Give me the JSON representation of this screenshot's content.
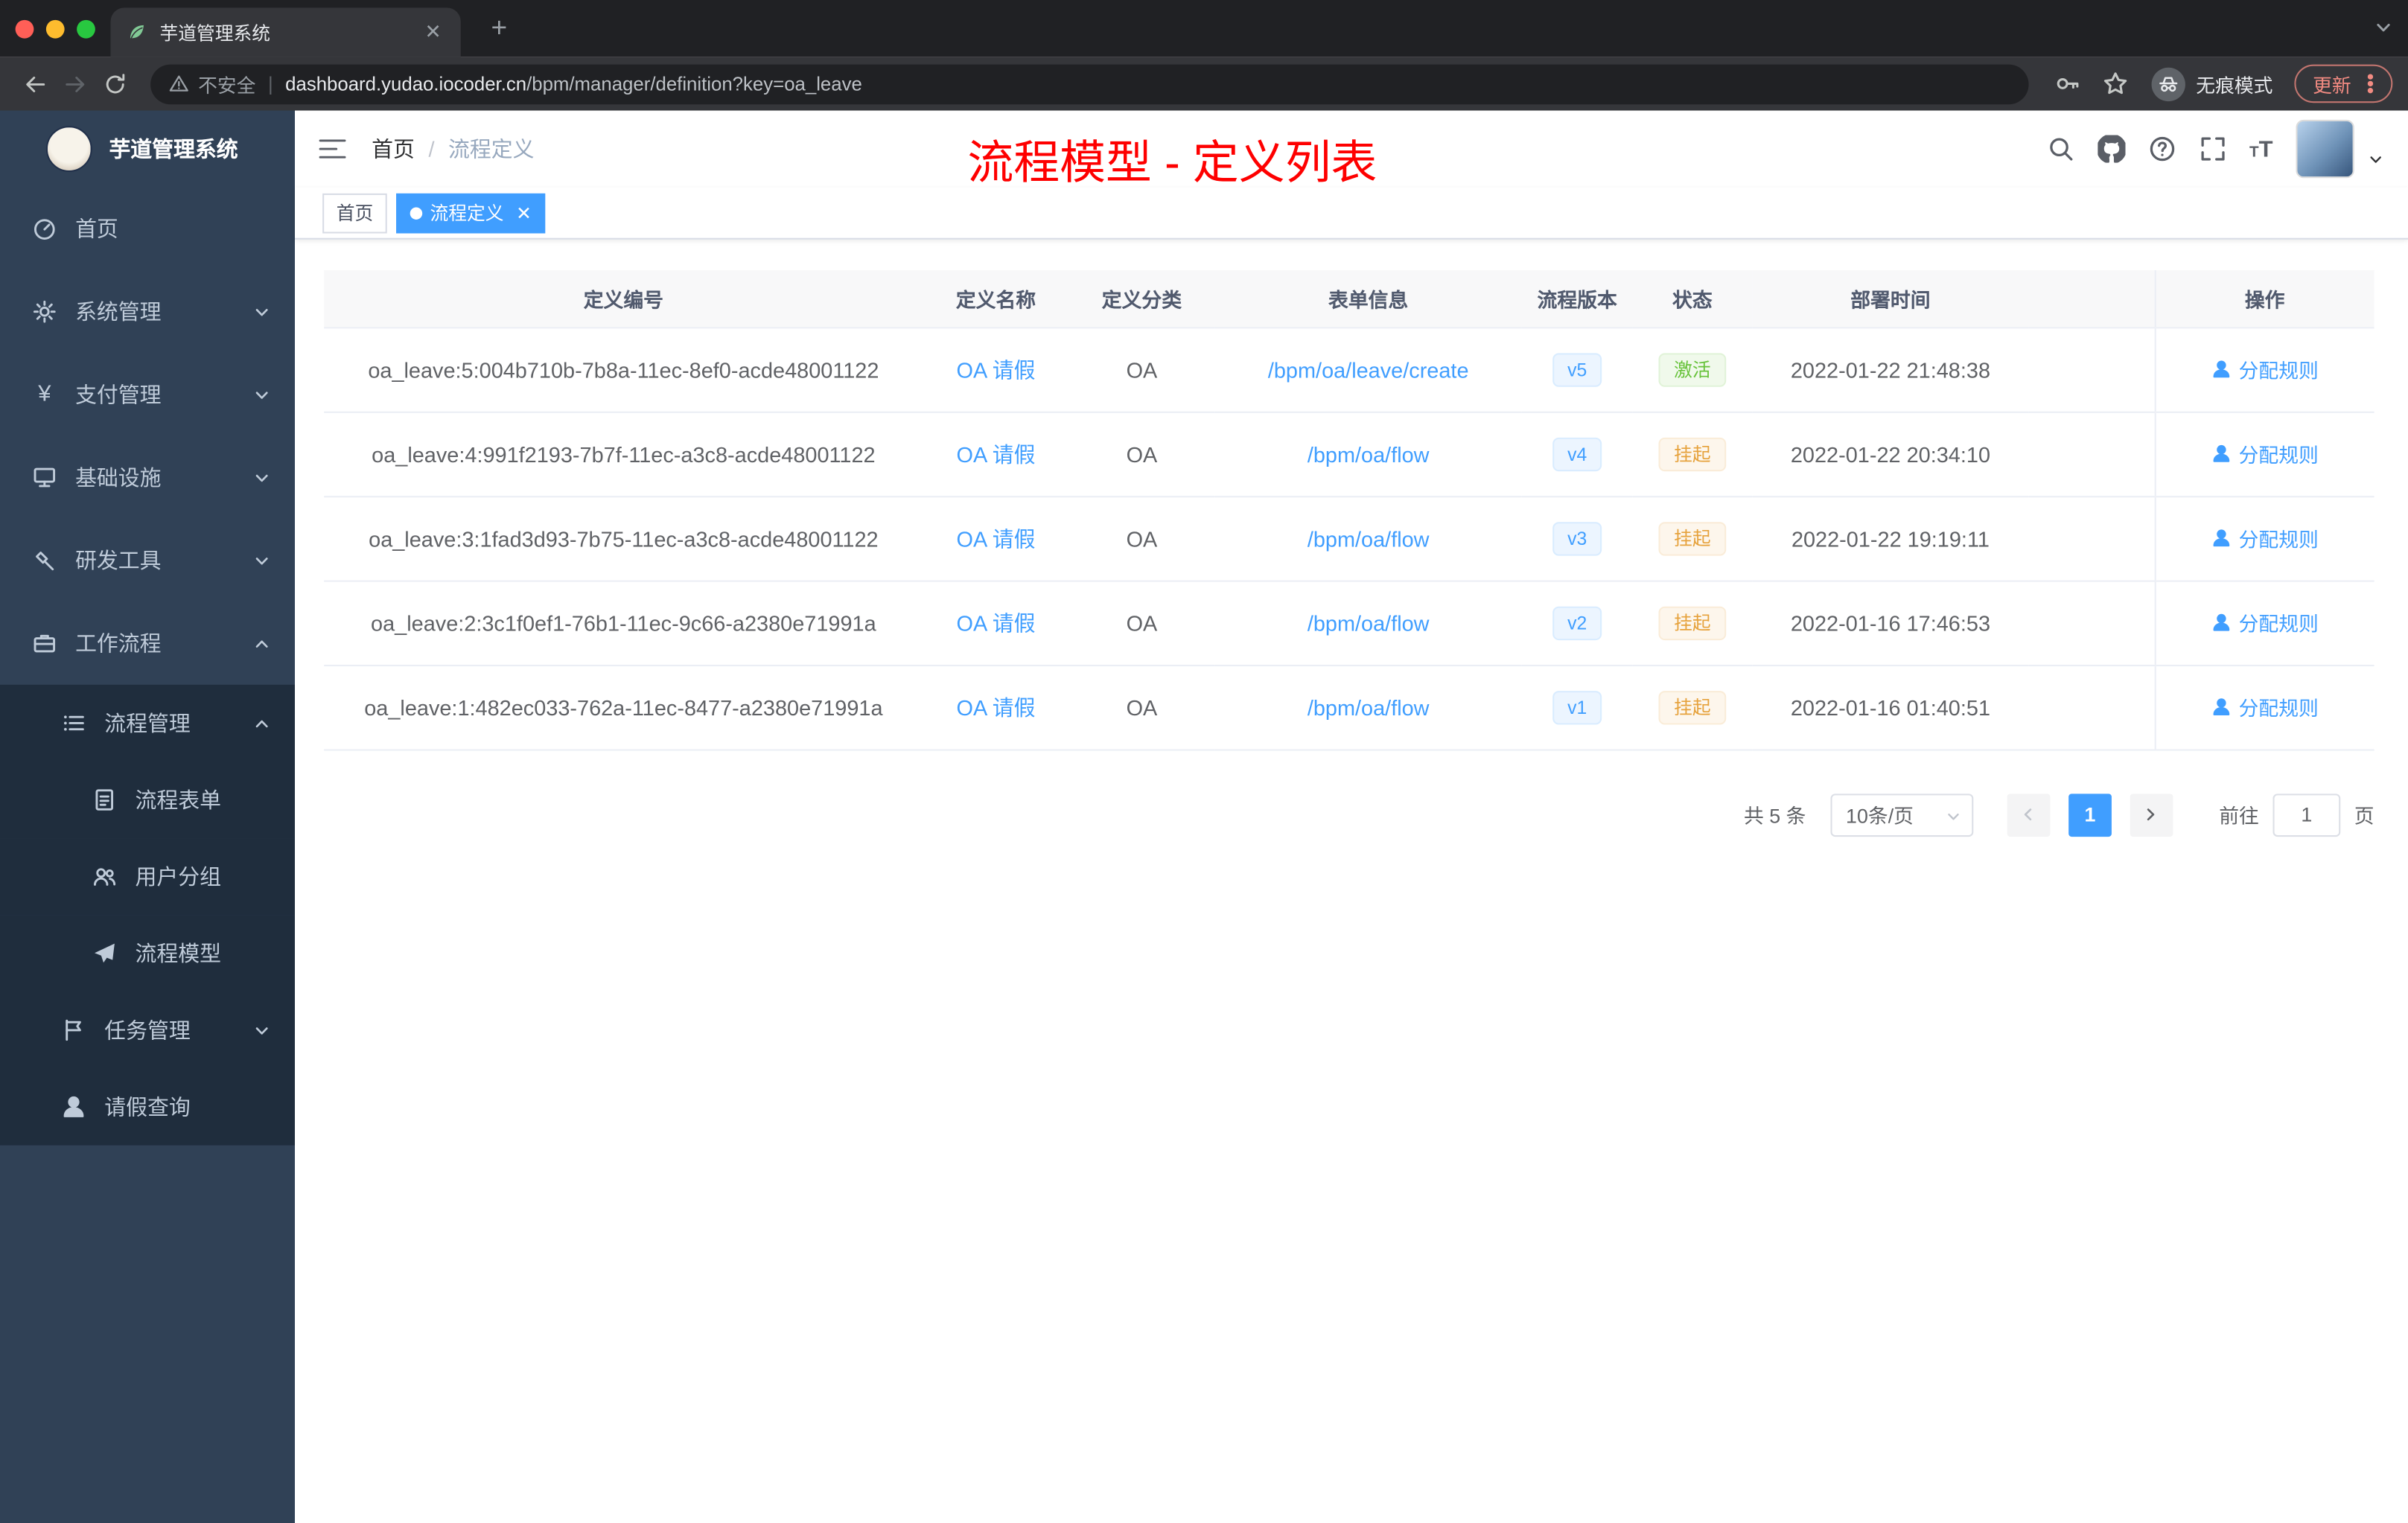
{
  "colors": {
    "accent": "#409eff",
    "annotation": "#fe0000",
    "success": "#67c23a",
    "warning": "#e6a23c",
    "sidebar-bg": "#304156",
    "submenu-bg": "#1f2d3d"
  },
  "browser": {
    "tab_title": "芋道管理系统",
    "security_label": "不安全",
    "url_domain": "dashboard.yudao.iocoder.cn",
    "url_path": "/bpm/manager/definition?key=oa_leave",
    "incognito_label": "无痕模式",
    "update_label": "更新"
  },
  "sidebar": {
    "logo_title": "芋道管理系统",
    "menu": [
      {
        "key": "home",
        "label": "首页",
        "icon": "dashboard-icon",
        "level": 0
      },
      {
        "key": "system",
        "label": "系统管理",
        "icon": "gear-icon",
        "level": 0,
        "chevron": "down"
      },
      {
        "key": "payment",
        "label": "支付管理",
        "icon": "yen-icon",
        "level": 0,
        "chevron": "down"
      },
      {
        "key": "infrastructure",
        "label": "基础设施",
        "icon": "monitor-icon",
        "level": 0,
        "chevron": "down"
      },
      {
        "key": "dev-tools",
        "label": "研发工具",
        "icon": "tool-icon",
        "level": 0,
        "chevron": "down"
      },
      {
        "key": "workflow",
        "label": "工作流程",
        "icon": "briefcase-icon",
        "level": 0,
        "chevron": "up"
      },
      {
        "key": "process-manage",
        "label": "流程管理",
        "icon": "list-icon",
        "level": 1,
        "chevron": "up"
      },
      {
        "key": "process-form",
        "label": "流程表单",
        "icon": "document-icon",
        "level": 2
      },
      {
        "key": "user-group",
        "label": "用户分组",
        "icon": "users-icon",
        "level": 2
      },
      {
        "key": "process-model",
        "label": "流程模型",
        "icon": "send-icon",
        "level": 2
      },
      {
        "key": "task-manage",
        "label": "任务管理",
        "icon": "flag-icon",
        "level": 1,
        "chevron": "down"
      },
      {
        "key": "leave-query",
        "label": "请假查询",
        "icon": "user-icon",
        "level": 1
      }
    ]
  },
  "header": {
    "breadcrumb": [
      "首页",
      "流程定义"
    ],
    "annotation": "流程模型 - 定义列表"
  },
  "tags_view": {
    "home": "首页",
    "active": "流程定义"
  },
  "table": {
    "columns": [
      "定义编号",
      "定义名称",
      "定义分类",
      "表单信息",
      "流程版本",
      "状态",
      "部署时间",
      "操作"
    ],
    "rows": [
      {
        "id": "oa_leave:5:004b710b-7b8a-11ec-8ef0-acde48001122",
        "name": "OA 请假",
        "category": "OA",
        "form": "/bpm/oa/leave/create",
        "version": "v5",
        "status": "激活",
        "status_type": "success",
        "deploy_time": "2022-01-22 21:48:38",
        "action": "分配规则"
      },
      {
        "id": "oa_leave:4:991f2193-7b7f-11ec-a3c8-acde48001122",
        "name": "OA 请假",
        "category": "OA",
        "form": "/bpm/oa/flow",
        "version": "v4",
        "status": "挂起",
        "status_type": "warning",
        "deploy_time": "2022-01-22 20:34:10",
        "action": "分配规则"
      },
      {
        "id": "oa_leave:3:1fad3d93-7b75-11ec-a3c8-acde48001122",
        "name": "OA 请假",
        "category": "OA",
        "form": "/bpm/oa/flow",
        "version": "v3",
        "status": "挂起",
        "status_type": "warning",
        "deploy_time": "2022-01-22 19:19:11",
        "action": "分配规则"
      },
      {
        "id": "oa_leave:2:3c1f0ef1-76b1-11ec-9c66-a2380e71991a",
        "name": "OA 请假",
        "category": "OA",
        "form": "/bpm/oa/flow",
        "version": "v2",
        "status": "挂起",
        "status_type": "warning",
        "deploy_time": "2022-01-16 17:46:53",
        "action": "分配规则"
      },
      {
        "id": "oa_leave:1:482ec033-762a-11ec-8477-a2380e71991a",
        "name": "OA 请假",
        "category": "OA",
        "form": "/bpm/oa/flow",
        "version": "v1",
        "status": "挂起",
        "status_type": "warning",
        "deploy_time": "2022-01-16 01:40:51",
        "action": "分配规则"
      }
    ]
  },
  "pagination": {
    "total": "共 5 条",
    "page_size": "10条/页",
    "current_page": "1",
    "goto_label": "前往",
    "goto_value": "1",
    "page_unit": "页"
  }
}
